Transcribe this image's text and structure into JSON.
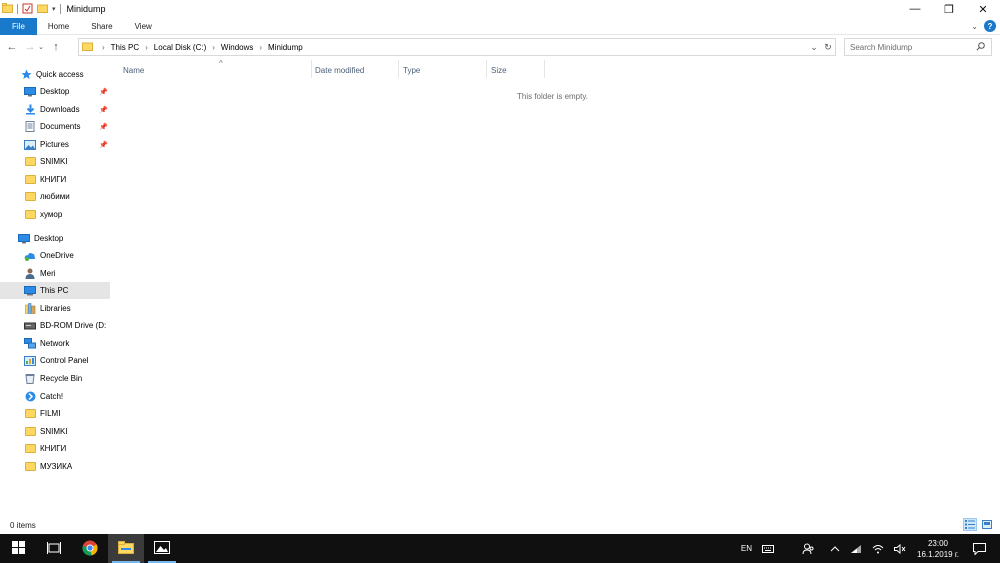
{
  "window": {
    "title": "Minidump",
    "controls": {
      "minimize": "—",
      "restore": "❐",
      "close": "✕"
    }
  },
  "ribbon": {
    "tabs": [
      {
        "label": "File",
        "active": true
      },
      {
        "label": "Home"
      },
      {
        "label": "Share"
      },
      {
        "label": "View"
      }
    ],
    "help": "?"
  },
  "address": {
    "crumbs": [
      "This PC",
      "Local Disk (C:)",
      "Windows",
      "Minidump"
    ],
    "refresh_icon": "↻",
    "dropdown_icon": "⌄"
  },
  "search": {
    "placeholder": "Search Minidump"
  },
  "nav_pane": {
    "quick_access_label": "Quick access",
    "items": [
      {
        "label": "Quick access",
        "icon": "star-icon"
      },
      {
        "label": "Desktop",
        "icon": "desktop-icon",
        "pinned": true
      },
      {
        "label": "Downloads",
        "icon": "downloads-icon",
        "pinned": true
      },
      {
        "label": "Documents",
        "icon": "documents-icon",
        "pinned": true
      },
      {
        "label": "Pictures",
        "icon": "pictures-icon",
        "pinned": true
      },
      {
        "label": "SNIMKI",
        "icon": "folder-icon"
      },
      {
        "label": "КНИГИ",
        "icon": "folder-icon"
      },
      {
        "label": "любими",
        "icon": "folder-icon"
      },
      {
        "label": "хумор",
        "icon": "folder-icon"
      },
      {
        "label": "Desktop",
        "icon": "desktop-icon"
      },
      {
        "label": "OneDrive",
        "icon": "onedrive-icon"
      },
      {
        "label": "Meri",
        "icon": "user-icon"
      },
      {
        "label": "This PC",
        "icon": "pc-icon",
        "selected": true
      },
      {
        "label": "Libraries",
        "icon": "libraries-icon"
      },
      {
        "label": "BD-ROM Drive (D:",
        "icon": "disc-icon"
      },
      {
        "label": "Network",
        "icon": "network-icon"
      },
      {
        "label": "Control Panel",
        "icon": "control-panel-icon"
      },
      {
        "label": "Recycle Bin",
        "icon": "recycle-bin-icon"
      },
      {
        "label": "Catch!",
        "icon": "catch-icon"
      },
      {
        "label": "FILMI",
        "icon": "folder-icon"
      },
      {
        "label": "SNIMKI",
        "icon": "folder-icon"
      },
      {
        "label": "КНИГИ",
        "icon": "folder-icon"
      },
      {
        "label": "МУЗИКА",
        "icon": "folder-icon"
      }
    ]
  },
  "content": {
    "columns": [
      "Name",
      "Date modified",
      "Type",
      "Size"
    ],
    "empty_message": "This folder is empty."
  },
  "status": {
    "item_count": "0 items"
  },
  "taskbar": {
    "language": "EN",
    "time": "23:00",
    "date": "16.1.2019 г."
  },
  "colors": {
    "accent": "#1979ca",
    "selection": "#e5e5e5",
    "taskbar": "#101010"
  }
}
